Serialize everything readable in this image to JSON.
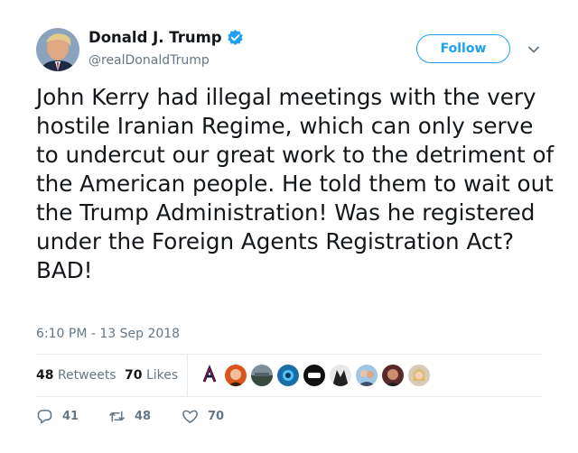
{
  "user": {
    "display_name": "Donald J. Trump",
    "handle": "@realDonaldTrump"
  },
  "follow_label": "Follow",
  "tweet": {
    "text": "John Kerry had illegal meetings with the very hostile Iranian Regime, which can only serve to undercut our great work to the detriment of the American people. He told them to wait out the Trump Administration! Was he registered under the Foreign Agents Registration Act? BAD!",
    "timestamp": "6:10 PM - 13 Sep 2018"
  },
  "stats": {
    "retweets_count": "48",
    "retweets_label": "Retweets",
    "likes_count": "70",
    "likes_label": "Likes"
  },
  "actions": {
    "replies": "41",
    "retweets": "48",
    "likes": "70"
  },
  "colors": {
    "accent": "#1da1f2",
    "muted": "#657786",
    "text": "#14171a",
    "border": "#e6ecf0"
  }
}
